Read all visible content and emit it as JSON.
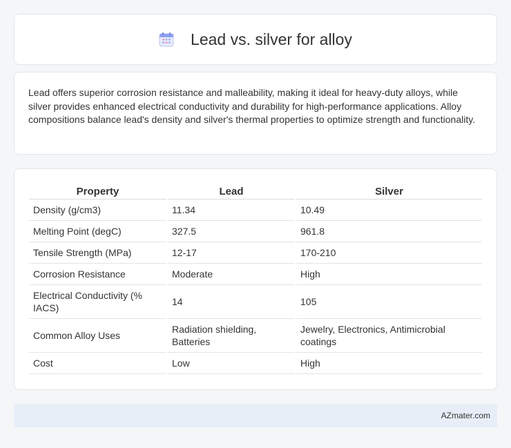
{
  "header": {
    "title": "Lead vs. silver for alloy",
    "icon": "calendar-icon"
  },
  "description": "Lead offers superior corrosion resistance and malleability, making it ideal for heavy-duty alloys, while silver provides enhanced electrical conductivity and durability for high-performance applications. Alloy compositions balance lead's density and silver's thermal properties to optimize strength and functionality.",
  "table": {
    "headers": [
      "Property",
      "Lead",
      "Silver"
    ],
    "rows": [
      [
        "Density (g/cm3)",
        "11.34",
        "10.49"
      ],
      [
        "Melting Point (degC)",
        "327.5",
        "961.8"
      ],
      [
        "Tensile Strength (MPa)",
        "12-17",
        "170-210"
      ],
      [
        "Corrosion Resistance",
        "Moderate",
        "High"
      ],
      [
        "Electrical Conductivity (% IACS)",
        "14",
        "105"
      ],
      [
        "Common Alloy Uses",
        "Radiation shielding, Batteries",
        "Jewelry, Electronics, Antimicrobial coatings"
      ],
      [
        "Cost",
        "Low",
        "High"
      ]
    ]
  },
  "footer": {
    "brand": "AZmater.com"
  },
  "colors": {
    "background": "#f5f6f8",
    "card": "#ffffff",
    "footer_bg": "#e8eef8",
    "icon_accent": "#7b8fe0"
  }
}
